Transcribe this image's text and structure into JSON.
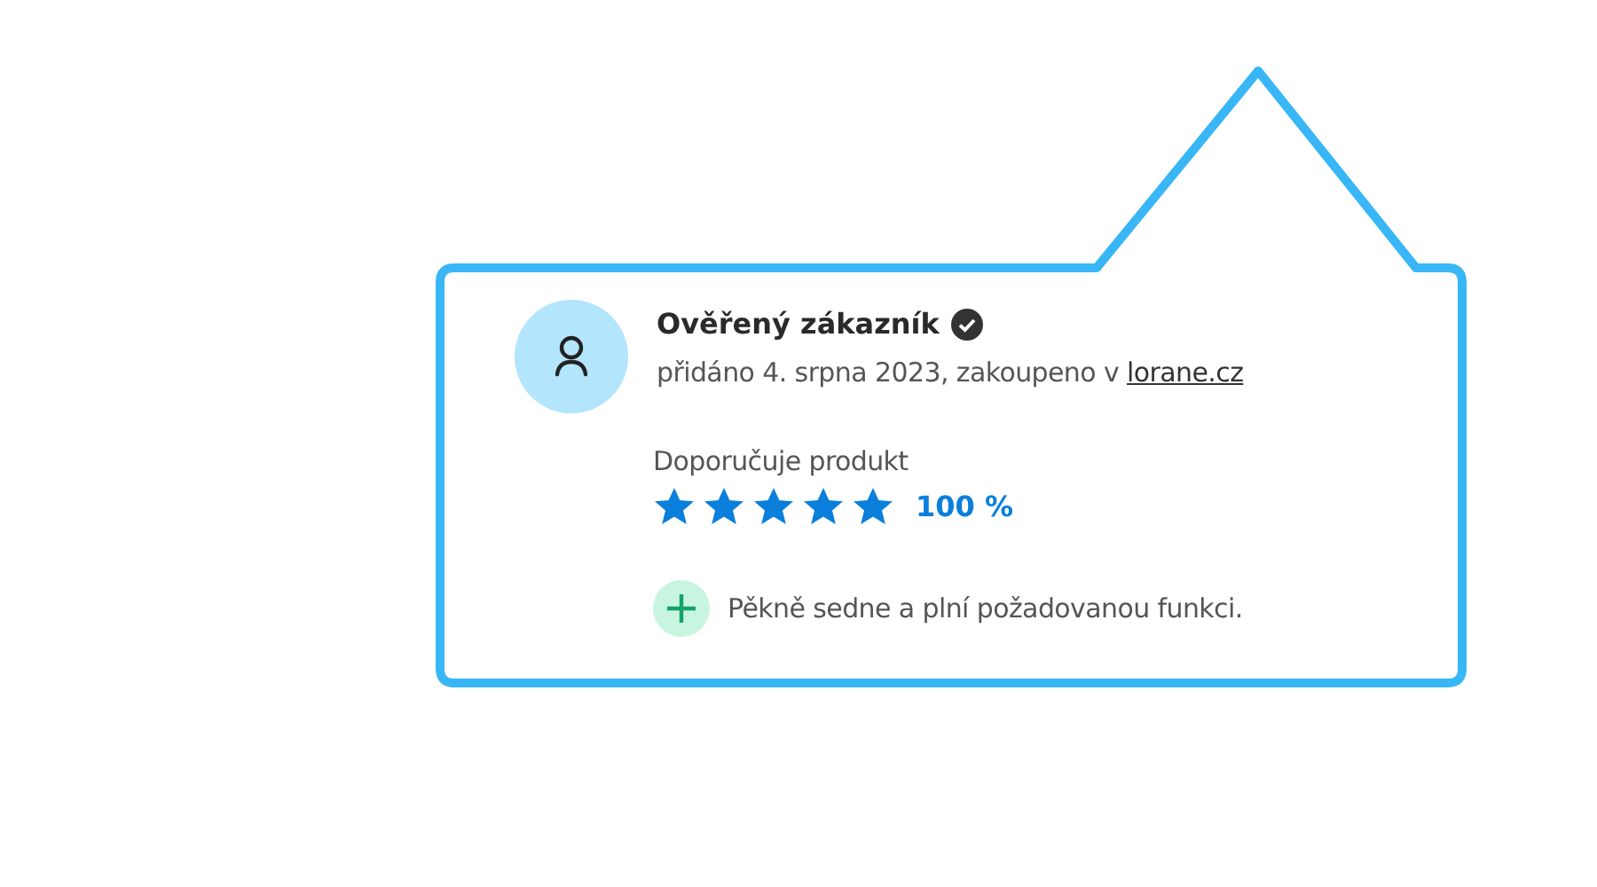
{
  "review": {
    "author": "Ověřený zákazník",
    "verified": true,
    "meta": "přidáno 4. srpna 2023, zakoupeno v",
    "shop_link": "lorane.cz",
    "recommend_label": "Doporučuje produkt",
    "stars": 5,
    "percent": "100 %",
    "points": [
      {
        "kind": "plus",
        "text": "Pěkně sedne a plní požadovanou funkci."
      }
    ]
  }
}
